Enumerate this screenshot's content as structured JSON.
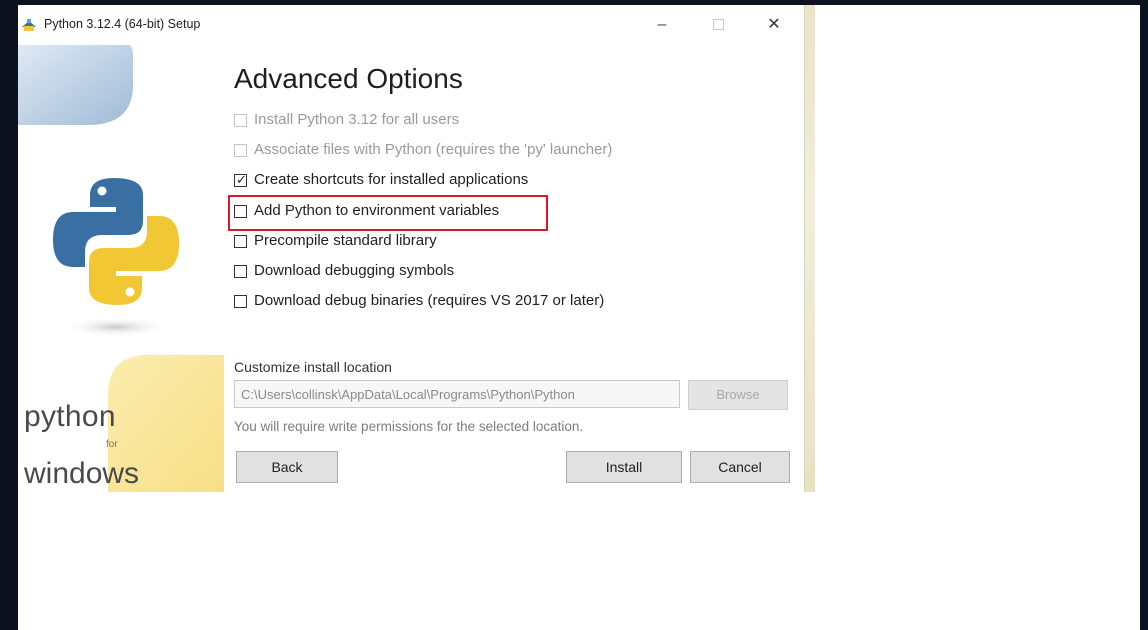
{
  "window": {
    "title": "Python 3.12.4 (64-bit) Setup",
    "controls": {
      "minimize": "–",
      "maximize": "",
      "close": "✕"
    }
  },
  "branding": {
    "line1": "python",
    "line2": "for",
    "line3": "windows"
  },
  "page": {
    "heading": "Advanced Options"
  },
  "options": [
    {
      "label": "Install Python 3.12 for all users",
      "checked": false,
      "enabled": false
    },
    {
      "label": "Associate files with Python (requires the 'py' launcher)",
      "checked": false,
      "enabled": false
    },
    {
      "label": "Create shortcuts for installed applications",
      "checked": true,
      "enabled": true
    },
    {
      "label": "Add Python to environment variables",
      "checked": false,
      "enabled": true,
      "highlighted": true
    },
    {
      "label": "Precompile standard library",
      "checked": false,
      "enabled": true
    },
    {
      "label": "Download debugging symbols",
      "checked": false,
      "enabled": true
    },
    {
      "label": "Download debug binaries (requires VS 2017 or later)",
      "checked": false,
      "enabled": true
    }
  ],
  "location": {
    "label": "Customize install location",
    "value": "C:\\Users\\collinsk\\AppData\\Local\\Programs\\Python\\Python",
    "browse_label": "Browse",
    "note": "You will require write permissions for the selected location."
  },
  "buttons": {
    "back": "Back",
    "install": "Install",
    "cancel": "Cancel"
  },
  "colors": {
    "highlight": "#d9182b",
    "python_blue": "#3a6fa3",
    "python_yellow": "#f2c734"
  }
}
